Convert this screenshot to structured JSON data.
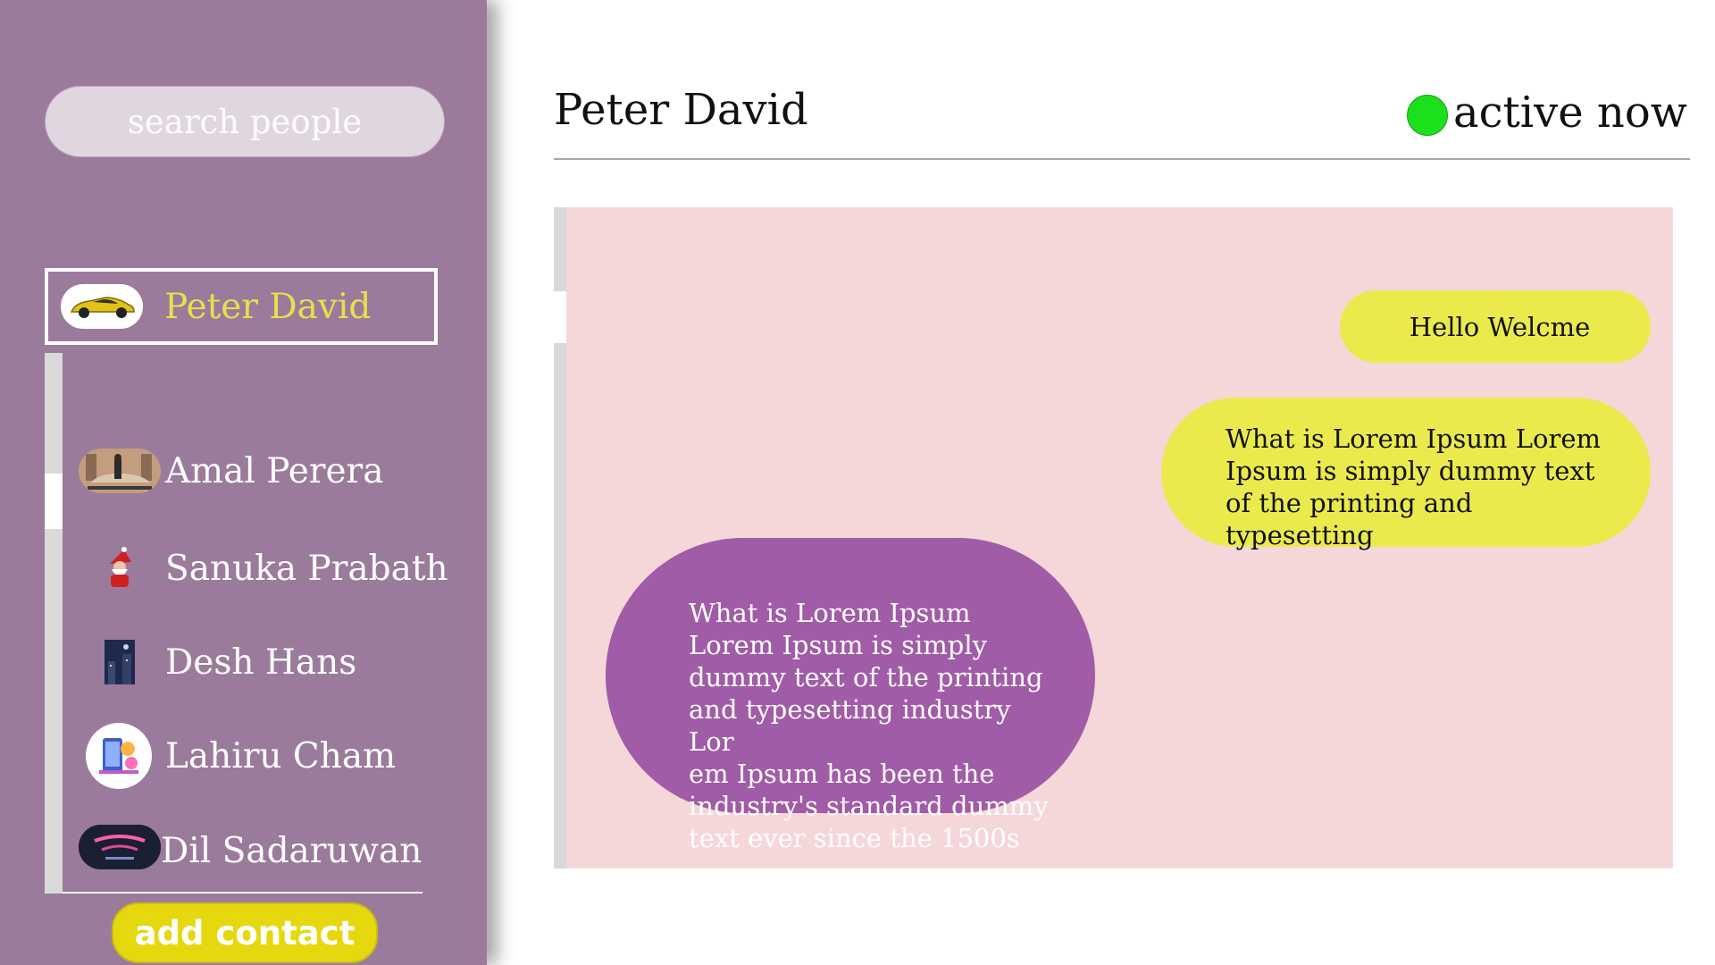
{
  "sidebar": {
    "search": {
      "placeholder": "search people"
    },
    "contacts": [
      {
        "name": "Peter David",
        "avatar": "yellow-sports-car-avatar",
        "active": true
      },
      {
        "name": "Amal Perera",
        "avatar": "person-with-car-avatar",
        "active": false
      },
      {
        "name": "Sanuka Prabath",
        "avatar": "santa-claus-avatar",
        "active": false
      },
      {
        "name": "Desh Hans",
        "avatar": "night-city-avatar",
        "active": false
      },
      {
        "name": "Lahiru Cham",
        "avatar": "phone-illustration-avatar",
        "active": false
      },
      {
        "name": "Dil Sadaruwan",
        "avatar": "fest-poster-avatar",
        "active": false
      }
    ],
    "add_contact_label": "add contact"
  },
  "chat": {
    "title": "Peter David",
    "status": "active now",
    "messages": [
      {
        "direction": "out",
        "text": "Hello Welcme"
      },
      {
        "direction": "out",
        "text": "What is Lorem Ipsum Lorem Ipsum is simply dummy text of the printing and typesetting"
      },
      {
        "direction": "in",
        "text": "What is Lorem Ipsum\nLorem Ipsum is simply\ndummy text of the printing\nand typesetting industry Lor\nem Ipsum has been the\n industry's standard dummy\n text ever since the 1500s"
      }
    ]
  },
  "colors": {
    "sidebar_bg": "#9b7b9b",
    "active_name": "#e8e04a",
    "add_button": "#e5d80f",
    "chat_bg": "#f5d7da",
    "outgoing_bubble": "#eaea4d",
    "incoming_bubble": "#a05ca6",
    "status_dot": "#1de01d"
  }
}
